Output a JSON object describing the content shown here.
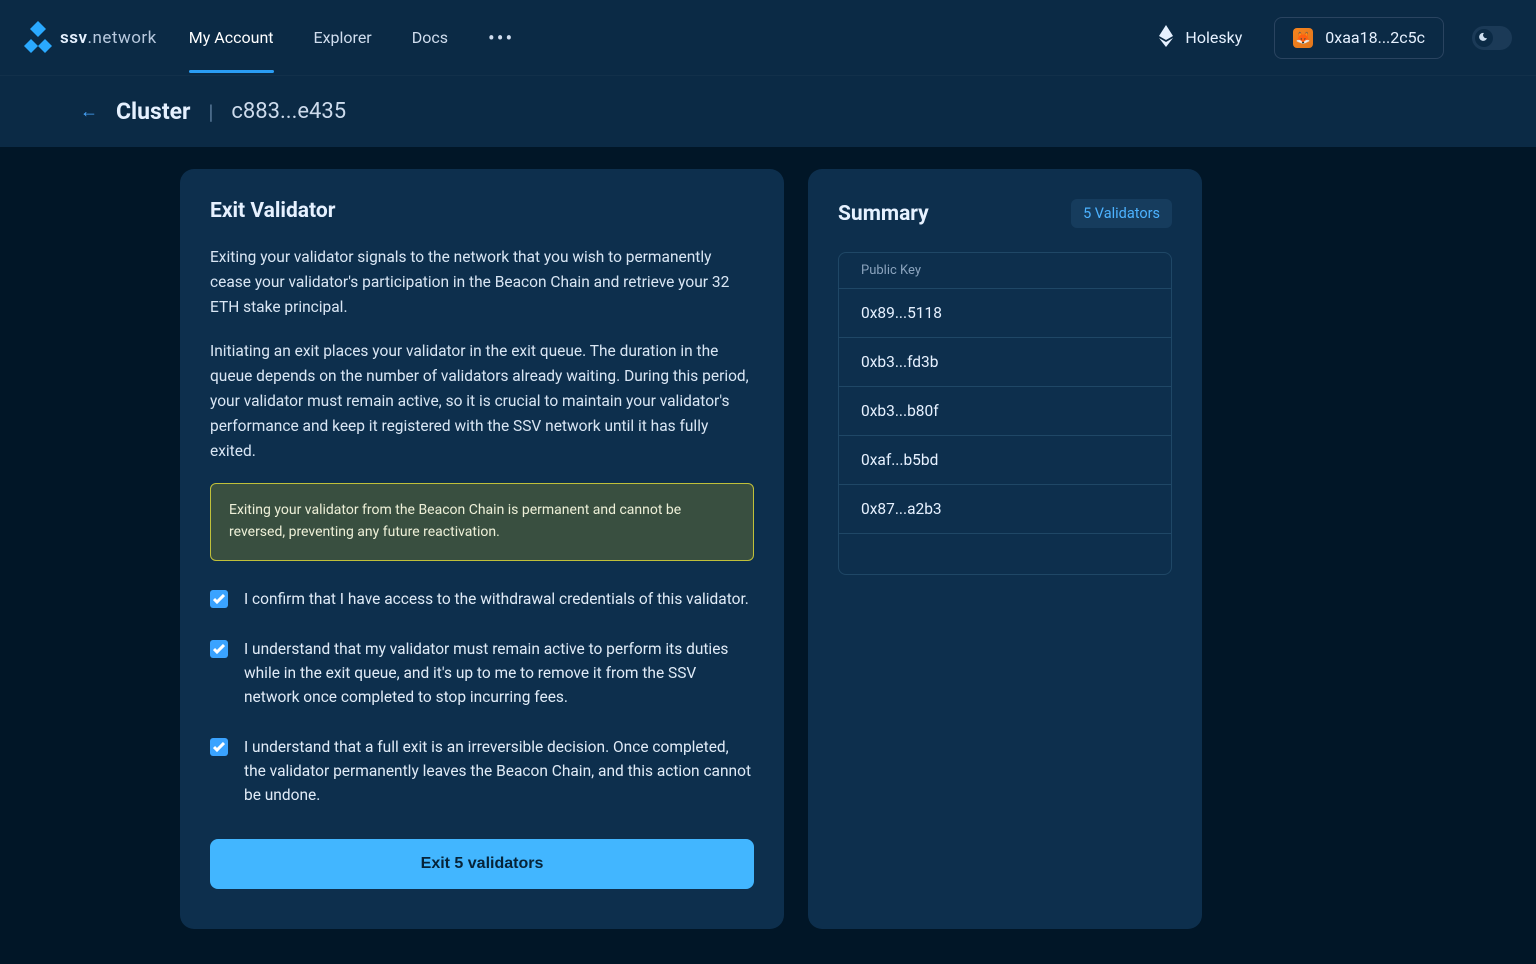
{
  "brand": {
    "name1": "ssv",
    "name2": ".network"
  },
  "nav": {
    "my_account": "My Account",
    "explorer": "Explorer",
    "docs": "Docs"
  },
  "network": {
    "name": "Holesky"
  },
  "wallet": {
    "address": "0xaa18...2c5c"
  },
  "breadcrumb": {
    "label": "Cluster",
    "id": "c883...e435"
  },
  "main": {
    "title": "Exit Validator",
    "p1": "Exiting your validator signals to the network that you wish to permanently cease your validator's participation in the Beacon Chain and retrieve your 32 ETH stake principal.",
    "p2": "Initiating an exit places your validator in the exit queue. The duration in the queue depends on the number of validators already waiting. During this period, your validator must remain active, so it is crucial to maintain your validator's performance and keep it registered with the SSV network until it has fully exited.",
    "warning": "Exiting your validator from the Beacon Chain is permanent and cannot be reversed, preventing any future reactivation.",
    "checks": [
      "I confirm that I have access to the withdrawal credentials of this validator.",
      "I understand that my validator must remain active to perform its duties while in the exit queue, and it's up to me to remove it from the SSV network once completed to stop incurring fees.",
      "I understand that a full exit is an irreversible decision. Once completed, the validator permanently leaves the Beacon Chain, and this action cannot be undone."
    ],
    "button": "Exit 5 validators"
  },
  "summary": {
    "title": "Summary",
    "badge": "5 Validators",
    "header": "Public Key",
    "keys": [
      "0x89...5118",
      "0xb3...fd3b",
      "0xb3...b80f",
      "0xaf...b5bd",
      "0x87...a2b3"
    ]
  }
}
